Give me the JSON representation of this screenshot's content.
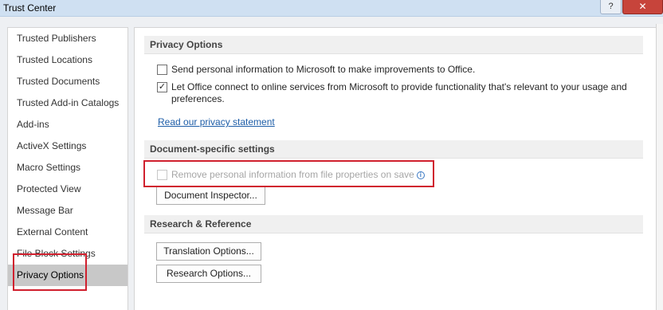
{
  "window": {
    "title": "Trust Center",
    "help_label": "?",
    "close_label": "✕"
  },
  "sidebar": {
    "items": [
      {
        "label": "Trusted Publishers"
      },
      {
        "label": "Trusted Locations"
      },
      {
        "label": "Trusted Documents"
      },
      {
        "label": "Trusted Add-in Catalogs"
      },
      {
        "label": "Add-ins"
      },
      {
        "label": "ActiveX Settings"
      },
      {
        "label": "Macro Settings"
      },
      {
        "label": "Protected View"
      },
      {
        "label": "Message Bar"
      },
      {
        "label": "External Content"
      },
      {
        "label": "File Block Settings"
      },
      {
        "label": "Privacy Options",
        "selected": true
      }
    ]
  },
  "main": {
    "privacy": {
      "header": "Privacy Options",
      "send_info": {
        "label": "Send personal information to Microsoft to make improvements to Office.",
        "checked": false
      },
      "connect_online": {
        "label": "Let Office connect to online services from Microsoft to provide functionality that's relevant to your usage and preferences.",
        "checked": true
      },
      "privacy_link": "Read our privacy statement"
    },
    "document_specific": {
      "header": "Document-specific settings",
      "remove_personal": {
        "label": "Remove personal information from file properties on save",
        "checked": false,
        "disabled": true
      },
      "inspector_button": "Document Inspector..."
    },
    "research": {
      "header": "Research & Reference",
      "translation_button": "Translation Options...",
      "research_button": "Research Options..."
    }
  },
  "colors": {
    "highlight": "#d0202e",
    "link": "#1e5ea8",
    "selected_item": "#c8c8c8"
  }
}
